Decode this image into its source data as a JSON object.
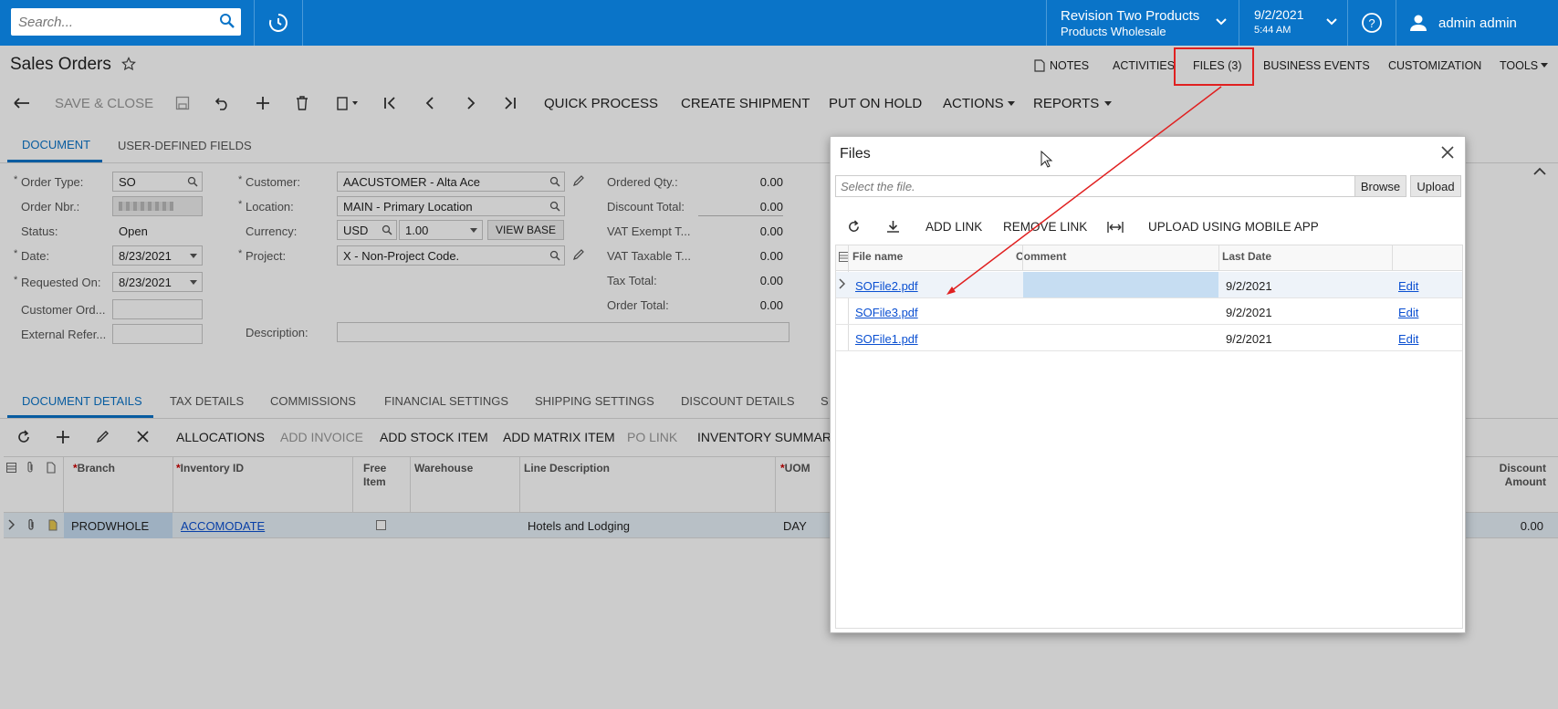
{
  "topbar": {
    "search_placeholder": "Search...",
    "company_name": "Revision Two Products",
    "company_branch": "Products Wholesale",
    "date": "9/2/2021",
    "time": "5:44 AM",
    "user": "admin admin"
  },
  "page": {
    "title": "Sales Orders",
    "links": [
      "NOTES",
      "ACTIVITIES",
      "FILES (3)",
      "BUSINESS EVENTS",
      "CUSTOMIZATION",
      "TOOLS"
    ]
  },
  "toolbar": {
    "save_close": "SAVE & CLOSE",
    "quick_process": "QUICK PROCESS",
    "create_shipment": "CREATE SHIPMENT",
    "put_on_hold": "PUT ON HOLD",
    "actions": "ACTIONS",
    "reports": "REPORTS"
  },
  "form_tabs": [
    "DOCUMENT",
    "USER-DEFINED FIELDS"
  ],
  "form": {
    "order_type_label": "Order Type:",
    "order_type": "SO",
    "order_nbr_label": "Order Nbr.:",
    "status_label": "Status:",
    "status": "Open",
    "date_label": "Date:",
    "date": "8/23/2021",
    "requested_on_label": "Requested On:",
    "requested_on": "8/23/2021",
    "customer_ord_label": "Customer Ord...",
    "external_ref_label": "External Refer...",
    "customer_label": "Customer:",
    "customer": "AACUSTOMER - Alta Ace",
    "location_label": "Location:",
    "location": "MAIN - Primary Location",
    "currency_label": "Currency:",
    "currency": "USD",
    "rate": "1.00",
    "view_base": "VIEW BASE",
    "project_label": "Project:",
    "project": "X - Non-Project Code.",
    "description_label": "Description:",
    "ordered_qty_label": "Ordered Qty.:",
    "ordered_qty": "0.00",
    "discount_total_label": "Discount Total:",
    "discount_total": "0.00",
    "vat_exempt_label": "VAT Exempt T...",
    "vat_exempt": "0.00",
    "vat_taxable_label": "VAT Taxable T...",
    "vat_taxable": "0.00",
    "tax_total_label": "Tax Total:",
    "tax_total": "0.00",
    "order_total_label": "Order Total:",
    "order_total": "0.00"
  },
  "detail_tabs": [
    "DOCUMENT DETAILS",
    "TAX DETAILS",
    "COMMISSIONS",
    "FINANCIAL SETTINGS",
    "SHIPPING SETTINGS",
    "DISCOUNT DETAILS",
    "S"
  ],
  "detail_toolbar": {
    "allocations": "ALLOCATIONS",
    "add_invoice": "ADD INVOICE",
    "add_stock_item": "ADD STOCK ITEM",
    "add_matrix_item": "ADD MATRIX ITEM",
    "po_link": "PO LINK",
    "inventory_summary": "INVENTORY SUMMARY"
  },
  "grid": {
    "headers": {
      "branch": "Branch",
      "inventory_id": "Inventory ID",
      "free_item_1": "Free",
      "free_item_2": "Item",
      "warehouse": "Warehouse",
      "line_description": "Line Description",
      "uom": "UOM",
      "discount_amount_1": "Discount",
      "discount_amount_2": "Amount"
    },
    "row": {
      "branch": "PRODWHOLE",
      "inventory_id": "ACCOMODATE",
      "line_description": "Hotels and Lodging",
      "uom": "DAY",
      "discount_amount": "0.00"
    }
  },
  "files_dialog": {
    "title": "Files",
    "file_placeholder": "Select the file.",
    "browse": "Browse",
    "upload": "Upload",
    "add_link": "ADD LINK",
    "remove_link": "REMOVE LINK",
    "upload_mobile": "UPLOAD USING MOBILE APP",
    "headers": {
      "file_name": "File name",
      "comment": "Comment",
      "last_date": "Last Date"
    },
    "rows": [
      {
        "file_name": "SOFile2.pdf",
        "last_date": "9/2/2021",
        "edit": "Edit"
      },
      {
        "file_name": "SOFile3.pdf",
        "last_date": "9/2/2021",
        "edit": "Edit"
      },
      {
        "file_name": "SOFile1.pdf",
        "last_date": "9/2/2021",
        "edit": "Edit"
      }
    ]
  },
  "colors": {
    "accent": "#0a74c8",
    "link": "#0a4fd1",
    "callout": "#e02020"
  }
}
